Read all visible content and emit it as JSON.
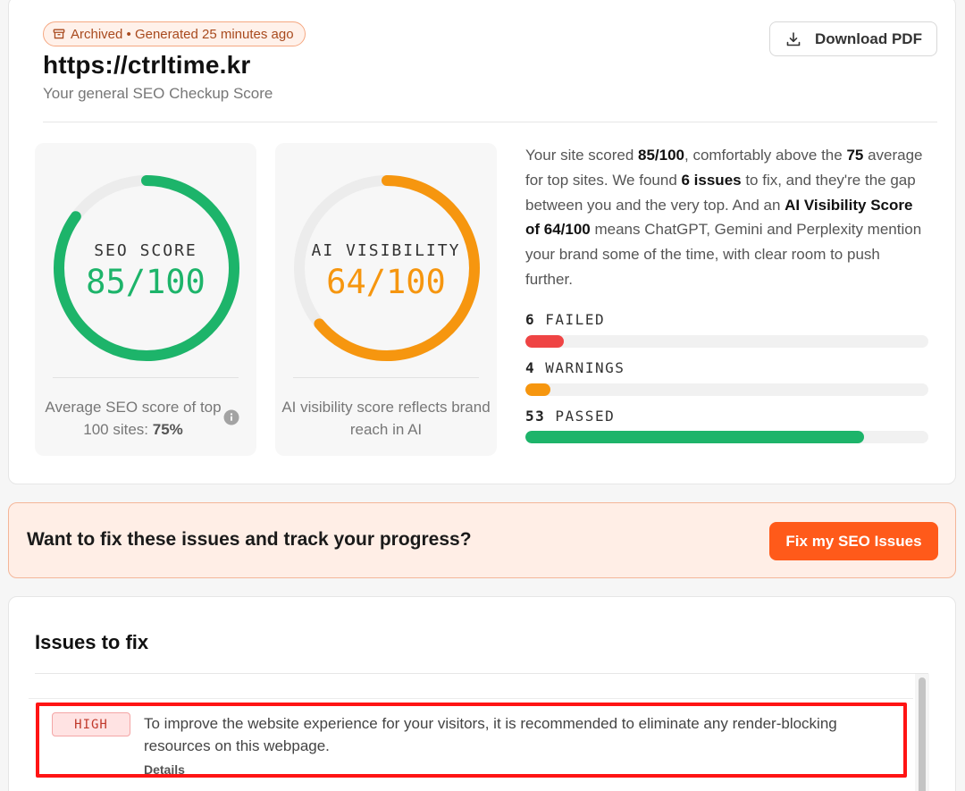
{
  "header": {
    "status_text": "Archived • Generated 25 minutes ago",
    "site_url": "https://ctrltime.kr",
    "subtitle": "Your general SEO Checkup Score",
    "download_label": "Download PDF"
  },
  "seo_score": {
    "label": "SEO SCORE",
    "value_text": "85/100",
    "value": 85,
    "max": 100,
    "color": "#1db46a",
    "caption_prefix": "Average SEO score of top 100 sites:",
    "caption_value": "75%"
  },
  "ai_visibility": {
    "label": "AI VISIBILITY",
    "value_text": "64/100",
    "value": 64,
    "max": 100,
    "color": "#f6960f",
    "caption": "AI visibility score reflects brand reach in AI"
  },
  "summary": {
    "t1": "Your site scored ",
    "b1": "85/100",
    "t2": ", comfortably above the ",
    "b2": "75",
    "t3": " average for top sites. We found ",
    "b3": "6 issues",
    "t4": " to fix, and they're the gap between you and the very top. And an ",
    "b4": "AI Visibility Score of 64/100",
    "t5": " means ChatGPT, Gemini and Perplexity mention your brand some of the time, with clear room to push further."
  },
  "metrics": {
    "failed": {
      "count": "6",
      "label": "FAILED",
      "fraction": 0.095,
      "color": "#ef4444"
    },
    "warnings": {
      "count": "4",
      "label": "WARNINGS",
      "fraction": 0.063,
      "color": "#f6960f"
    },
    "passed": {
      "count": "53",
      "label": "PASSED",
      "fraction": 0.841,
      "color": "#1db46a"
    }
  },
  "cta": {
    "text": "Want to fix these issues and track your progress?",
    "button_label": "Fix my SEO Issues"
  },
  "issues": {
    "title": "Issues to fix",
    "items": [
      {
        "severity": "HIGH",
        "text": "To improve the website experience for your visitors, it is recommended to eliminate any render-blocking resources on this webpage.",
        "details_label": "Details"
      }
    ]
  },
  "colors": {
    "accent": "#ff5a1a",
    "highlight_border": "#ff1414"
  },
  "icons": {
    "archive": "archive-icon",
    "download": "download-icon",
    "info": "info-icon"
  }
}
